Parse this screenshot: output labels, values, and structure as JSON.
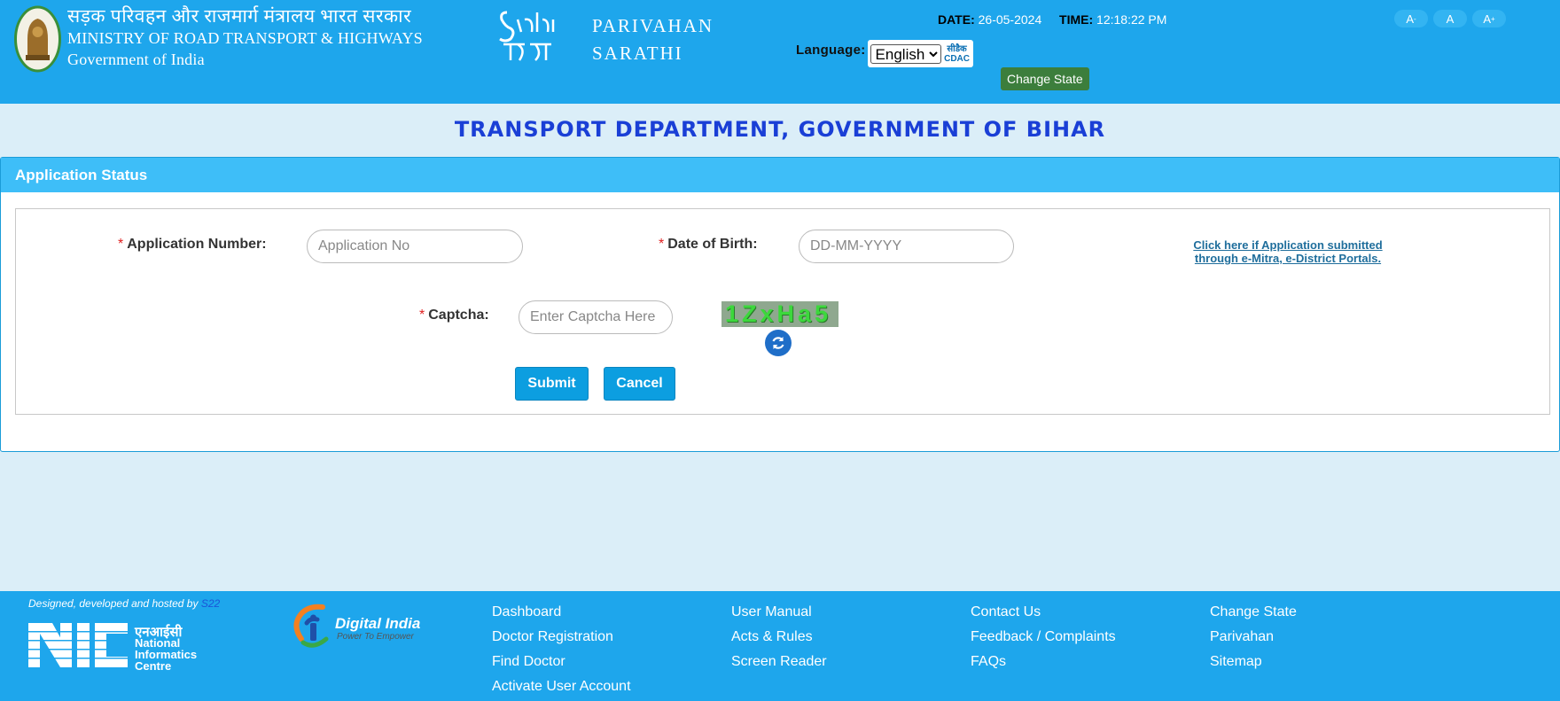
{
  "header": {
    "ministry_hindi": "सड़क परिवहन और राजमार्ग मंत्रालय भारत सरकार",
    "ministry_english": "MINISTRY OF ROAD TRANSPORT & HIGHWAYS",
    "government": "Government of India",
    "sarathi_line1": "PARIVAHAN",
    "sarathi_line2": "SARATHI",
    "date_label": "DATE:",
    "date_value": "26-05-2024",
    "time_label": "TIME:",
    "time_value": "12:18:22 PM",
    "language_label": "Language:",
    "language_selected": "English",
    "cdac_hindi": "सीडैक",
    "cdac_english": "CDAC",
    "change_state": "Change State",
    "font_decrease": "A",
    "font_normal": "A",
    "font_increase": "A"
  },
  "department_title": "TRANSPORT DEPARTMENT, GOVERNMENT OF BIHAR",
  "form": {
    "section_title": "Application Status",
    "required_mark": "*",
    "application_number_label": "Application Number:",
    "application_number_placeholder": "Application No",
    "dob_label": "Date of Birth:",
    "dob_placeholder": "DD-MM-YYYY",
    "portal_link": "Click here if Application submitted through e-Mitra, e-District Portals.",
    "captcha_label": "Captcha:",
    "captcha_placeholder": "Enter Captcha Here",
    "captcha_text": "1ZxHa5",
    "submit": "Submit",
    "cancel": "Cancel"
  },
  "footer": {
    "designed_by": "Designed, developed and hosted by",
    "designed_by_s22": "S22",
    "nic_hindi": "एनआईसी",
    "nic_line1": "National",
    "nic_line2": "Informatics",
    "nic_line3": "Centre",
    "digital_india": "Digital India",
    "digital_india_tagline": "Power To Empower",
    "col1": [
      "Dashboard",
      "Doctor Registration",
      "Find Doctor",
      "Activate User Account"
    ],
    "col2": [
      "User Manual",
      "Acts & Rules",
      "Screen Reader"
    ],
    "col3": [
      "Contact Us",
      "Feedback / Complaints",
      "FAQs"
    ],
    "col4": [
      "Change State",
      "Parivahan",
      "Sitemap"
    ]
  }
}
